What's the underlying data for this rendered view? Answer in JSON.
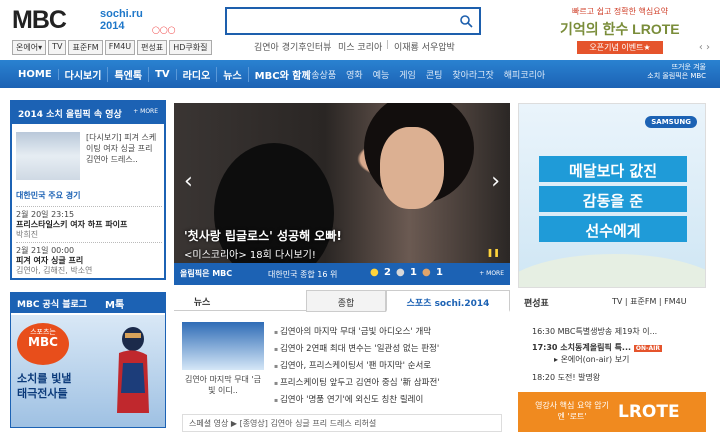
{
  "header": {
    "logo": "MBC",
    "sochi_logo": "sochi.ru 2014",
    "search_placeholder": "",
    "keywords": [
      "김연아 경기후인터뷰",
      "미스 코리아",
      "이재룡 서우압박"
    ],
    "sub_buttons": [
      "온에어▾",
      "TV",
      "표준FM",
      "FM4U",
      "편성표",
      "HD쿠화질"
    ]
  },
  "top_ad": {
    "line1": "빠르고 쉽고 정확한 핵심요약",
    "line2": "기억의 한수 LROTE",
    "line3": "오픈기념 이벤트★"
  },
  "nav": {
    "main": [
      "HOME",
      "다시보기",
      "특엔톡",
      "TV",
      "라디오",
      "뉴스",
      "MBC와 함께"
    ],
    "sub": [
      "방송상품",
      "영화",
      "예능",
      "게임",
      "콘팅",
      "찾아라그잣",
      "해피코리아"
    ],
    "right_line1": "뜨거운 겨울",
    "right_line2": "소치 올림픽은 MBC"
  },
  "left": {
    "video_title": "2014 소치 올림픽 속 영상",
    "more": "+ MORE",
    "video_desc": "[다시보기] 피겨 스케이팅 여자 싱글 프리 김연아 드레스..",
    "schedule_title": "대한민국 주요 경기",
    "schedule": [
      {
        "time": "2월 20일 23:15",
        "name": "프리스타일스키 여자 하프 파이프",
        "players": "박희진"
      },
      {
        "time": "2월 21일 00:00",
        "name": "피겨 여자 싱글 프리",
        "players": "김연아, 김해진, 박소연"
      }
    ],
    "blog_title": "MBC 공식 블로그",
    "blog_brand": "M톡",
    "blog_badge_top": "스포츠는",
    "blog_badge_main": "MBC",
    "blog_text1": "소치를 빛낼",
    "blog_text2": "태극전사들"
  },
  "hero": {
    "caption1": "'첫사랑 립글로스' 성공해 오빠!",
    "caption2": "<미스코리아> 18회 다시보기!"
  },
  "olympic_bar": {
    "brand": "올림픽은 MBC",
    "korea": "대한민국 종합 16 위",
    "gold": "2",
    "silver": "1",
    "bronze": "1",
    "more": "+ MORE"
  },
  "news": {
    "tabs": [
      "뉴스",
      "종합",
      "스포츠 sochi.2014"
    ],
    "thumb_caption": "김연아 마지막 무대 '금빛 이디..",
    "items": [
      "김연아의 마지막 무대 '금빛 아디오스' 개막",
      "김연아 2연패 최대 변수는 '일관성 없는 판정'",
      "김연아, 프리스케이팅서 '팬 마지막' 순서로",
      "프리스케이팅 앞두고 김연아 중심 '新 삼파전'",
      "김연아 '명품 연기'에 외신도 칭찬 릴레이"
    ],
    "ticker": "스페셜 영상 ▶ [종영상] 김연아 싱글 프리 드레스 리허설"
  },
  "right": {
    "brand": "SAMSUNG",
    "msgs": [
      "메달보다 값진",
      "감동을 준",
      "선수에게"
    ],
    "tv_title": "편성표",
    "tv_tabs": "TV | 표준FM | FM4U",
    "tv_rows": [
      {
        "time": "16:30",
        "title": "MBC특별생방송 제19차 이..."
      },
      {
        "time": "17:30",
        "title": "소치동계올림픽 특..."
      },
      {
        "time": "",
        "title": "온에어(on-air) 보기"
      },
      {
        "time": "18:20",
        "title": "도전! 발명왕"
      }
    ],
    "onair_badge": "ON-AIR",
    "rote_small": "영강사 핵심 요약 암기엔 '로트'",
    "rote_big": "LROTE"
  }
}
